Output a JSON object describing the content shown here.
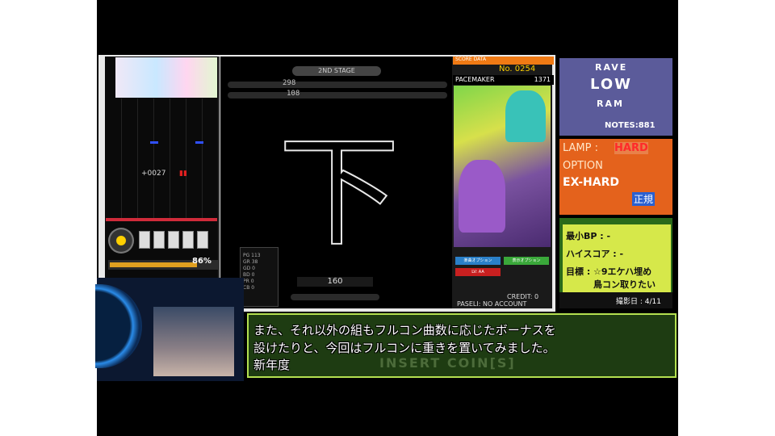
{
  "game": {
    "stage_label": "2ND STAGE",
    "hispeed_value": "298",
    "green_value": "108",
    "combo": "+0027",
    "gauge_value": "86%",
    "bpm": "160",
    "big_character": "下",
    "score_data_label": "SCORE DATA",
    "rank_no": "No. 0254",
    "pacemaker_label": "PACEMAKER",
    "pacemaker_value": "1371",
    "credit": "CREDIT: 0",
    "paseli": "PASELI: NO ACCOUNT",
    "score_rows": [
      "PG 113",
      "GR 38",
      "GD 0",
      "BD 0",
      "PR 0",
      "CB 0"
    ],
    "buttons": [
      "楽曲オプション",
      "表示オプション",
      "LV: AA"
    ],
    "colors": {
      "gauge": "#e0a020",
      "frame": "#e9e9e9",
      "score_header": "#f07a14"
    }
  },
  "info": {
    "level": "RAVE",
    "scratch": "LOW",
    "ram": "RAM",
    "notes": "NOTES:881",
    "lamp_label": "LAMP :",
    "lamp_value": "HARD",
    "option_label": "OPTION",
    "option_value": "EX-HARD",
    "option_sub": "正規",
    "min_bp": "最小BP : -",
    "hiscore": "ハイスコア : -",
    "goal_label": "目標 :",
    "goal_line1": "☆9エケハ埋め",
    "goal_line2": "鳥コン取りたい",
    "date": "撮影日 : 4/11"
  },
  "comment": {
    "line1": "また、それ以外の組もフルコン曲数に応じたボーナスを",
    "line2": "設けたりと、今回はフルコンに重きを置いてみました。",
    "line3": "新年度",
    "bg_text": "INSERT COIN[S]"
  }
}
